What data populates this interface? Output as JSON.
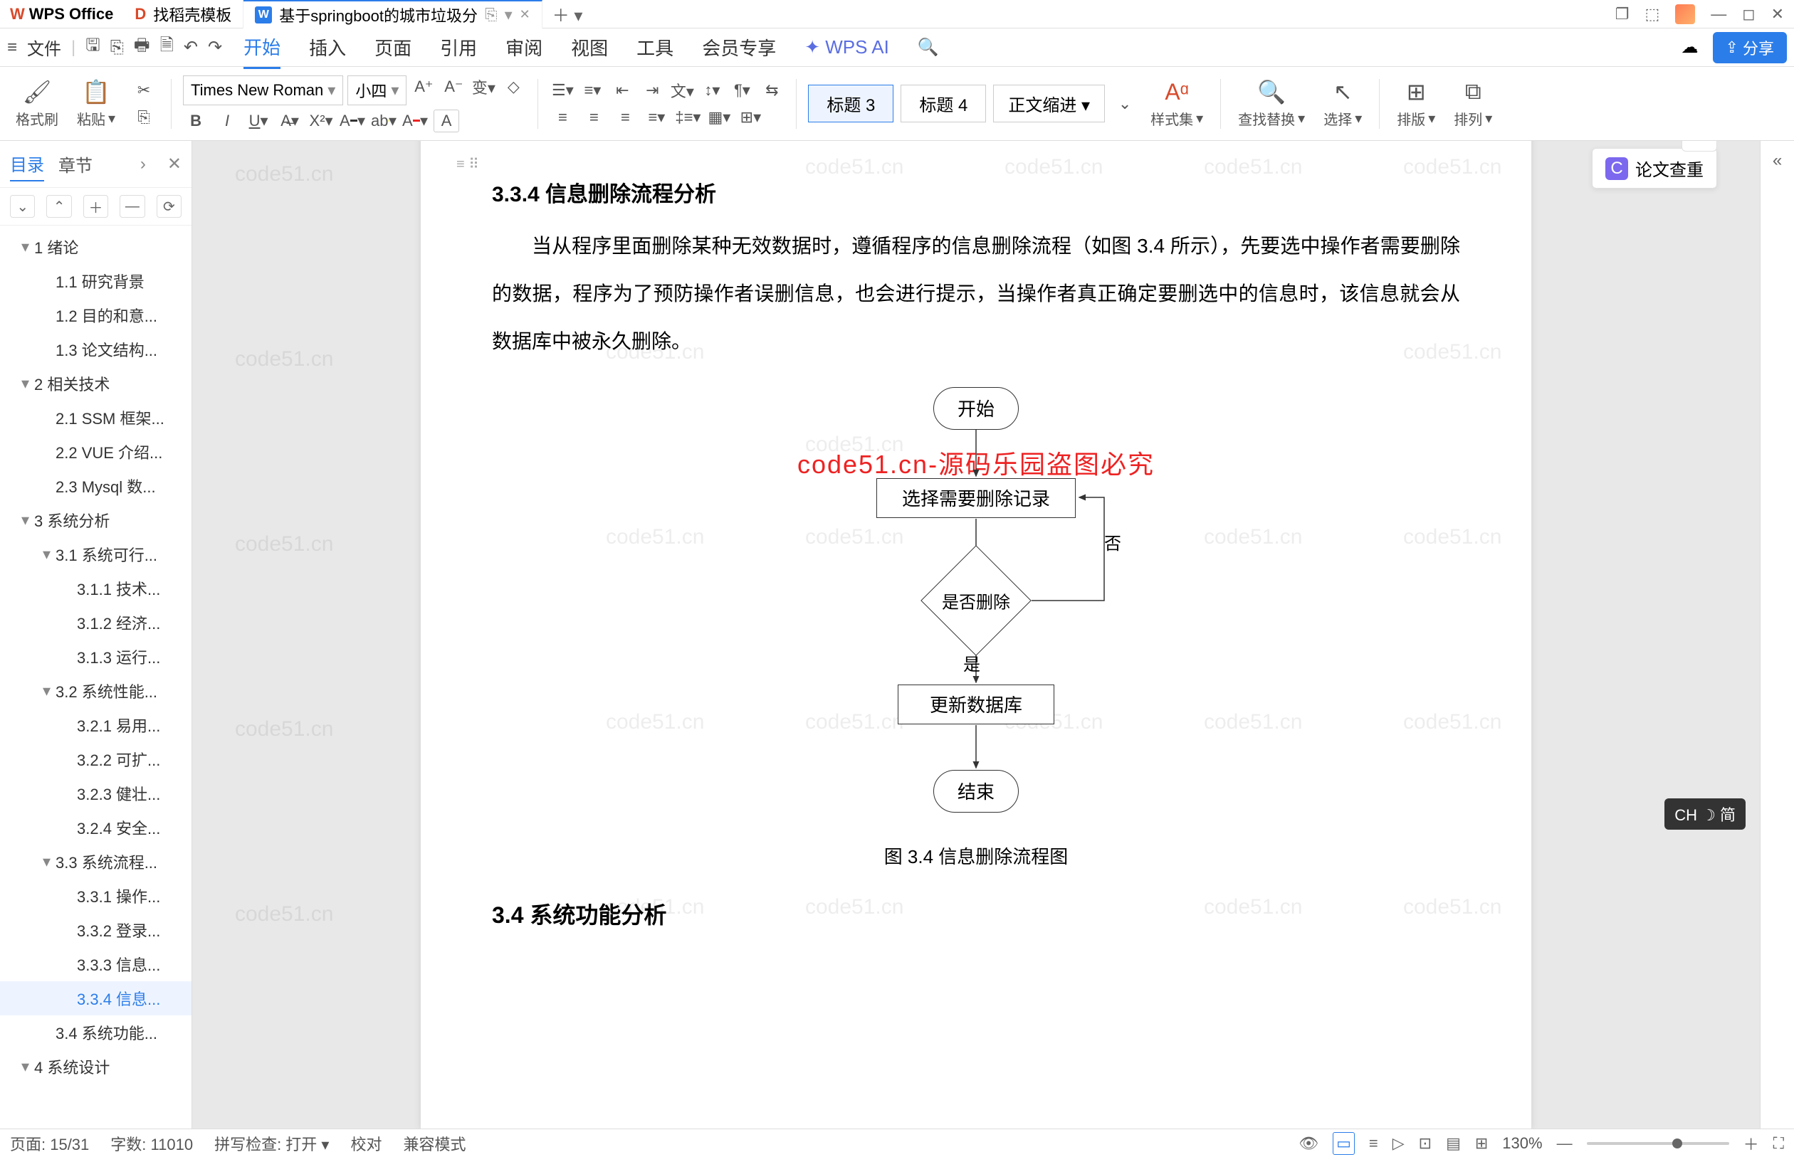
{
  "app_name": "WPS Office",
  "tabs": [
    {
      "icon": "D",
      "label": "找稻壳模板"
    },
    {
      "icon": "W",
      "label": "基于springboot的城市垃圾分",
      "active": true
    }
  ],
  "menu": {
    "items": [
      "开始",
      "插入",
      "页面",
      "引用",
      "审阅",
      "视图",
      "工具",
      "会员专享"
    ],
    "ai": "WPS AI",
    "active": "开始",
    "file": "文件",
    "share": "分享"
  },
  "ribbon": {
    "format_painter": "格式刷",
    "paste": "粘贴",
    "font_name": "Times New Roman",
    "font_size": "小四",
    "styles": [
      "标题 3",
      "标题 4",
      "正文缩进"
    ],
    "style_set": "样式集",
    "find_replace": "查找替换",
    "select": "选择",
    "arrange": "排版",
    "align": "排列"
  },
  "sidebar": {
    "tab_toc": "目录",
    "tab_chapters": "章节",
    "items": [
      {
        "lv": 1,
        "tri": true,
        "text": "1 绪论"
      },
      {
        "lv": 2,
        "text": "1.1 研究背景"
      },
      {
        "lv": 2,
        "text": "1.2 目的和意..."
      },
      {
        "lv": 2,
        "text": "1.3 论文结构..."
      },
      {
        "lv": 1,
        "tri": true,
        "text": "2 相关技术"
      },
      {
        "lv": 2,
        "text": "2.1 SSM 框架..."
      },
      {
        "lv": 2,
        "text": "2.2 VUE 介绍..."
      },
      {
        "lv": 2,
        "text": "2.3 Mysql 数..."
      },
      {
        "lv": 1,
        "tri": true,
        "text": "3 系统分析"
      },
      {
        "lv": 2,
        "tri": true,
        "text": "3.1 系统可行..."
      },
      {
        "lv": 3,
        "text": "3.1.1 技术..."
      },
      {
        "lv": 3,
        "text": "3.1.2 经济..."
      },
      {
        "lv": 3,
        "text": "3.1.3 运行..."
      },
      {
        "lv": 2,
        "tri": true,
        "text": "3.2 系统性能..."
      },
      {
        "lv": 3,
        "text": "3.2.1 易用..."
      },
      {
        "lv": 3,
        "text": "3.2.2 可扩..."
      },
      {
        "lv": 3,
        "text": "3.2.3 健壮..."
      },
      {
        "lv": 3,
        "text": "3.2.4 安全..."
      },
      {
        "lv": 2,
        "tri": true,
        "text": "3.3 系统流程..."
      },
      {
        "lv": 3,
        "text": "3.3.1 操作..."
      },
      {
        "lv": 3,
        "text": "3.3.2 登录..."
      },
      {
        "lv": 3,
        "text": "3.3.3 信息..."
      },
      {
        "lv": 3,
        "text": "3.3.4 信息...",
        "sel": true
      },
      {
        "lv": 2,
        "text": "3.4 系统功能..."
      },
      {
        "lv": 1,
        "tri": true,
        "text": "4 系统设计"
      }
    ]
  },
  "document": {
    "heading": "3.3.4  信息删除流程分析",
    "paragraph": "当从程序里面删除某种无效数据时，遵循程序的信息删除流程（如图 3.4 所示），先要选中操作者需要删除的数据，程序为了预防操作者误删信息，也会进行提示，当操作者真正确定要删选中的信息时，该信息就会从数据库中被永久删除。",
    "flow": {
      "start": "开始",
      "select": "选择需要删除记录",
      "decide": "是否删除",
      "yes": "是",
      "no": "否",
      "update": "更新数据库",
      "end": "结束"
    },
    "caption": "图 3.4  信息删除流程图",
    "next_heading": "3.4  系统功能分析",
    "watermark_red": "code51.cn-源码乐园盗图必究",
    "watermark_grey": "code51.cn"
  },
  "right_panel": {
    "paper_check": "论文查重"
  },
  "status": {
    "page": "页面: 15/31",
    "words": "字数: 11010",
    "spell": "拼写检查: 打开",
    "proof": "校对",
    "compat": "兼容模式",
    "zoom": "130%"
  },
  "ime": "CH ☽ 简"
}
